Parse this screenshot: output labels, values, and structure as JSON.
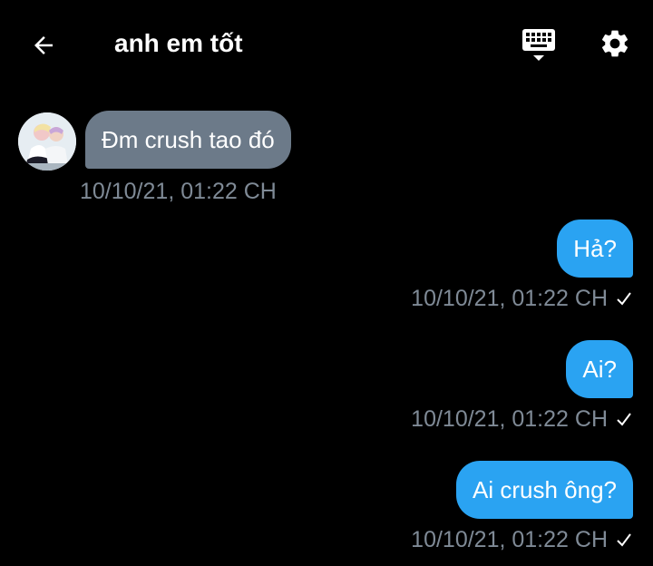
{
  "header": {
    "title": "anh em tốt",
    "back_icon": "arrow-left-icon",
    "keyboard_icon": "keyboard-icon",
    "settings_icon": "gear-icon"
  },
  "colors": {
    "background": "#000000",
    "incoming_bubble": "#6c7a89",
    "outgoing_bubble": "#2aa3f2",
    "timestamp": "#7f8a96",
    "text": "#ffffff"
  },
  "messages": [
    {
      "direction": "in",
      "text": "Đm crush tao đó",
      "time": "10/10/21, 01:22 CH"
    },
    {
      "direction": "out",
      "text": "Hả?",
      "time": "10/10/21, 01:22 CH",
      "status_icon": "check-icon"
    },
    {
      "direction": "out",
      "text": "Ai?",
      "time": "10/10/21, 01:22 CH",
      "status_icon": "check-icon"
    },
    {
      "direction": "out",
      "text": "Ai crush ông?",
      "time": "10/10/21, 01:22 CH",
      "status_icon": "check-icon"
    }
  ]
}
